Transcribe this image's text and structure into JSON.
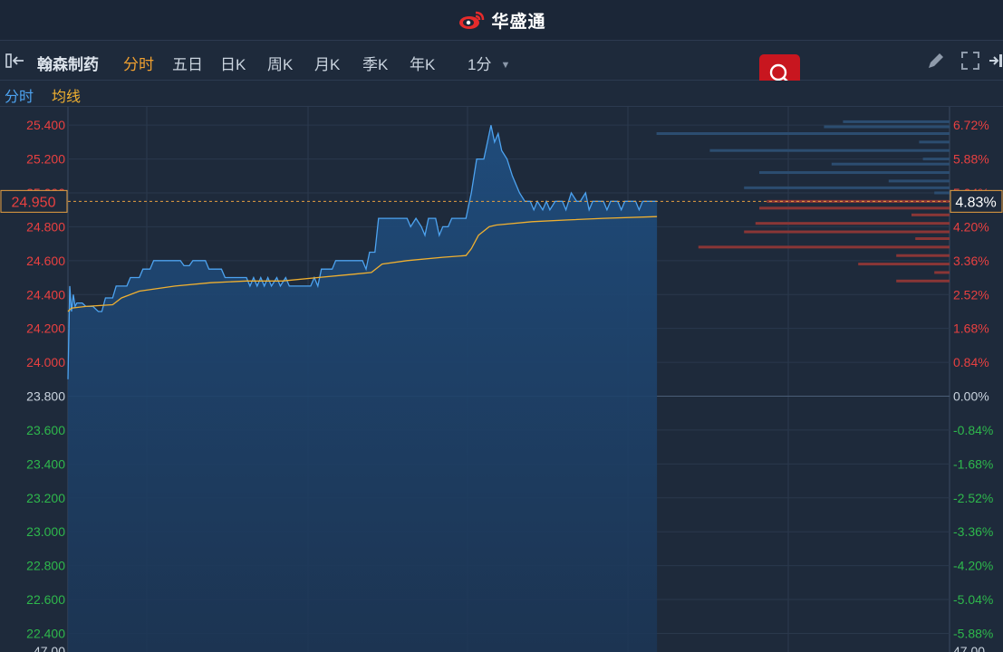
{
  "brand": {
    "name": "华盛通",
    "logo_icon": "weibo-style-eye-icon",
    "color": "#e52b2b"
  },
  "toolbar": {
    "stock_name": "翰森制药",
    "tabs": [
      "分时",
      "五日",
      "日K",
      "周K",
      "月K",
      "季K",
      "年K"
    ],
    "active_tab": "分时",
    "interval": "1分",
    "icons": [
      "sidebar-toggle-icon",
      "search-icon",
      "pencil-icon",
      "fullscreen-icon",
      "exit-icon"
    ]
  },
  "legend": {
    "price_label": "分时",
    "avg_label": "均线",
    "price_color": "#4da3f0",
    "avg_color": "#f0b030"
  },
  "colors": {
    "up": "#e84040",
    "down": "#2eb84c",
    "neutral": "#c9d3de",
    "accent": "#f0a030"
  },
  "chart_data": {
    "type": "line",
    "title": "",
    "prev_close": 23.8,
    "current_price": 24.95,
    "current_price_label": "24.950",
    "current_change_label": "4.83%",
    "ylim": [
      22.25,
      25.45
    ],
    "y_ticks_left": [
      "25.400",
      "25.200",
      "25.000",
      "24.800",
      "24.600",
      "24.400",
      "24.200",
      "24.000",
      "23.800",
      "23.600",
      "23.400",
      "23.200",
      "23.000",
      "22.800",
      "22.600",
      "22.400",
      "47.00"
    ],
    "y_ticks_right": [
      "6.72%",
      "5.88%",
      "5.04%",
      "4.20%",
      "3.36%",
      "2.52%",
      "1.68%",
      "0.84%",
      "0.00%",
      "-0.84%",
      "-1.68%",
      "-2.52%",
      "-3.36%",
      "-4.20%",
      "-5.04%",
      "-5.88%",
      "47.00"
    ],
    "x_range": [
      0,
      330
    ],
    "series": [
      {
        "name": "分时",
        "points": [
          [
            0,
            23.9
          ],
          [
            1,
            24.45
          ],
          [
            2,
            24.3
          ],
          [
            3,
            24.4
          ],
          [
            4,
            24.33
          ],
          [
            5,
            24.35
          ],
          [
            8,
            24.35
          ],
          [
            10,
            24.33
          ],
          [
            14,
            24.33
          ],
          [
            17,
            24.3
          ],
          [
            19,
            24.3
          ],
          [
            21,
            24.38
          ],
          [
            25,
            24.38
          ],
          [
            27,
            24.45
          ],
          [
            33,
            24.45
          ],
          [
            35,
            24.5
          ],
          [
            40,
            24.5
          ],
          [
            42,
            24.55
          ],
          [
            46,
            24.55
          ],
          [
            48,
            24.6
          ],
          [
            63,
            24.6
          ],
          [
            65,
            24.57
          ],
          [
            68,
            24.57
          ],
          [
            70,
            24.6
          ],
          [
            77,
            24.6
          ],
          [
            79,
            24.55
          ],
          [
            86,
            24.55
          ],
          [
            88,
            24.5
          ],
          [
            100,
            24.5
          ],
          [
            102,
            24.45
          ],
          [
            104,
            24.5
          ],
          [
            106,
            24.45
          ],
          [
            108,
            24.5
          ],
          [
            110,
            24.45
          ],
          [
            112,
            24.5
          ],
          [
            114,
            24.45
          ],
          [
            117,
            24.5
          ],
          [
            119,
            24.45
          ],
          [
            122,
            24.5
          ],
          [
            124,
            24.45
          ],
          [
            136,
            24.45
          ],
          [
            138,
            24.5
          ],
          [
            140,
            24.45
          ],
          [
            142,
            24.55
          ],
          [
            148,
            24.55
          ],
          [
            150,
            24.6
          ],
          [
            165,
            24.6
          ],
          [
            167,
            24.55
          ],
          [
            169,
            24.65
          ],
          [
            172,
            24.65
          ],
          [
            174,
            24.85
          ],
          [
            190,
            24.85
          ],
          [
            192,
            24.8
          ],
          [
            195,
            24.85
          ],
          [
            198,
            24.8
          ],
          [
            200,
            24.75
          ],
          [
            202,
            24.85
          ],
          [
            206,
            24.85
          ],
          [
            208,
            24.75
          ],
          [
            210,
            24.8
          ],
          [
            213,
            24.8
          ],
          [
            215,
            24.85
          ],
          [
            223,
            24.85
          ],
          [
            226,
            25.0
          ],
          [
            229,
            25.2
          ],
          [
            233,
            25.2
          ],
          [
            235,
            25.3
          ],
          [
            237,
            25.4
          ],
          [
            239,
            25.3
          ],
          [
            241,
            25.35
          ],
          [
            243,
            25.25
          ],
          [
            246,
            25.2
          ],
          [
            249,
            25.1
          ],
          [
            253,
            25.0
          ],
          [
            256,
            24.95
          ],
          [
            259,
            24.95
          ],
          [
            261,
            24.9
          ],
          [
            263,
            24.95
          ],
          [
            266,
            24.9
          ],
          [
            268,
            24.95
          ],
          [
            270,
            24.9
          ],
          [
            273,
            24.95
          ],
          [
            277,
            24.95
          ],
          [
            279,
            24.9
          ],
          [
            282,
            25.0
          ],
          [
            285,
            24.95
          ],
          [
            287,
            24.95
          ],
          [
            290,
            25.0
          ],
          [
            292,
            24.9
          ],
          [
            294,
            24.95
          ],
          [
            300,
            24.95
          ],
          [
            302,
            24.9
          ],
          [
            304,
            24.95
          ],
          [
            308,
            24.95
          ],
          [
            310,
            24.9
          ],
          [
            312,
            24.95
          ],
          [
            318,
            24.95
          ],
          [
            320,
            24.9
          ],
          [
            322,
            24.95
          ],
          [
            330,
            24.95
          ]
        ]
      },
      {
        "name": "均线",
        "points": [
          [
            0,
            24.3
          ],
          [
            2,
            24.32
          ],
          [
            10,
            24.33
          ],
          [
            25,
            24.34
          ],
          [
            30,
            24.38
          ],
          [
            40,
            24.42
          ],
          [
            60,
            24.45
          ],
          [
            80,
            24.47
          ],
          [
            100,
            24.48
          ],
          [
            120,
            24.48
          ],
          [
            140,
            24.5
          ],
          [
            160,
            24.52
          ],
          [
            170,
            24.53
          ],
          [
            176,
            24.58
          ],
          [
            190,
            24.6
          ],
          [
            210,
            24.62
          ],
          [
            223,
            24.63
          ],
          [
            226,
            24.67
          ],
          [
            230,
            24.75
          ],
          [
            236,
            24.8
          ],
          [
            240,
            24.81
          ],
          [
            260,
            24.83
          ],
          [
            280,
            24.84
          ],
          [
            300,
            24.85
          ],
          [
            330,
            24.86
          ]
        ]
      }
    ],
    "order_book": {
      "ask_color": "#2c4d70",
      "bid_color": "#8a3636",
      "asks": [
        {
          "price": 25.42,
          "size": 0.28
        },
        {
          "price": 25.39,
          "size": 0.33
        },
        {
          "price": 25.35,
          "size": 0.77
        },
        {
          "price": 25.3,
          "size": 0.08
        },
        {
          "price": 25.25,
          "size": 0.63
        },
        {
          "price": 25.2,
          "size": 0.07
        },
        {
          "price": 25.17,
          "size": 0.31
        },
        {
          "price": 25.12,
          "size": 0.5
        },
        {
          "price": 25.07,
          "size": 0.16
        },
        {
          "price": 25.03,
          "size": 0.54
        },
        {
          "price": 25.0,
          "size": 0.04
        }
      ],
      "bids": [
        {
          "price": 24.95,
          "size": 0.48
        },
        {
          "price": 24.91,
          "size": 0.5
        },
        {
          "price": 24.87,
          "size": 0.1
        },
        {
          "price": 24.82,
          "size": 0.51
        },
        {
          "price": 24.77,
          "size": 0.54
        },
        {
          "price": 24.73,
          "size": 0.09
        },
        {
          "price": 24.68,
          "size": 0.66
        },
        {
          "price": 24.63,
          "size": 0.14
        },
        {
          "price": 24.58,
          "size": 0.24
        },
        {
          "price": 24.53,
          "size": 0.04
        },
        {
          "price": 24.48,
          "size": 0.14
        }
      ]
    }
  }
}
